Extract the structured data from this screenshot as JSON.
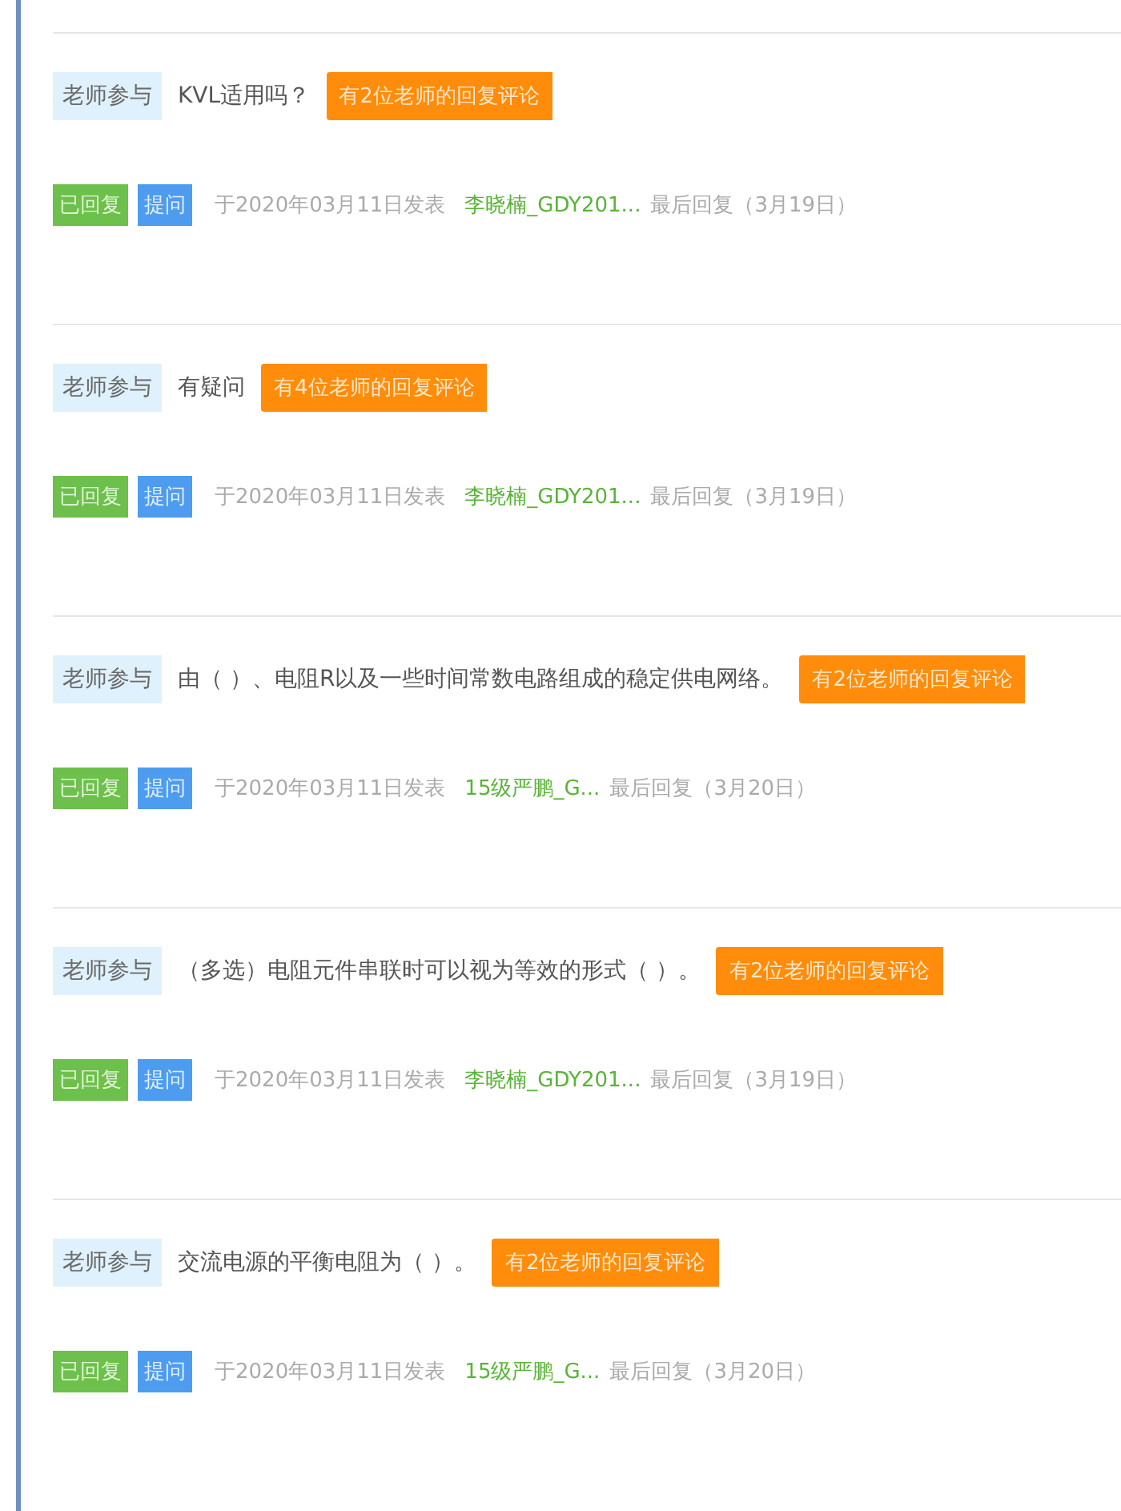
{
  "posts": [
    {
      "tag": "老师参与",
      "title": "KVL适用吗？",
      "badge": "有2位老师的回复评论",
      "status": "已回复",
      "type": "提问",
      "date": "于2020年03月11日发表",
      "author": "李晓楠_GDY201...",
      "last_reply": "最后回复（3月19日）"
    },
    {
      "tag": "老师参与",
      "title": "有疑问",
      "badge": "有4位老师的回复评论",
      "status": "已回复",
      "type": "提问",
      "date": "于2020年03月11日发表",
      "author": "李晓楠_GDY201...",
      "last_reply": "最后回复（3月19日）"
    },
    {
      "tag": "老师参与",
      "title": "由（ ）、电阻R以及一些时间常数电路组成的稳定供电网络。",
      "badge": "有2位老师的回复评论",
      "status": "已回复",
      "type": "提问",
      "date": "于2020年03月11日发表",
      "author": "15级严鹏_G...",
      "last_reply": "最后回复（3月20日）"
    },
    {
      "tag": "老师参与",
      "title": "（多选）电阻元件串联时可以视为等效的形式（ ）。",
      "badge": "有2位老师的回复评论",
      "status": "已回复",
      "type": "提问",
      "date": "于2020年03月11日发表",
      "author": "李晓楠_GDY201...",
      "last_reply": "最后回复（3月19日）"
    },
    {
      "tag": "老师参与",
      "title": "交流电源的平衡电阻为（ ）。",
      "badge": "有2位老师的回复评论",
      "status": "已回复",
      "type": "提问",
      "date": "于2020年03月11日发表",
      "author": "15级严鹏_G...",
      "last_reply": "最后回复（3月20日）"
    }
  ]
}
